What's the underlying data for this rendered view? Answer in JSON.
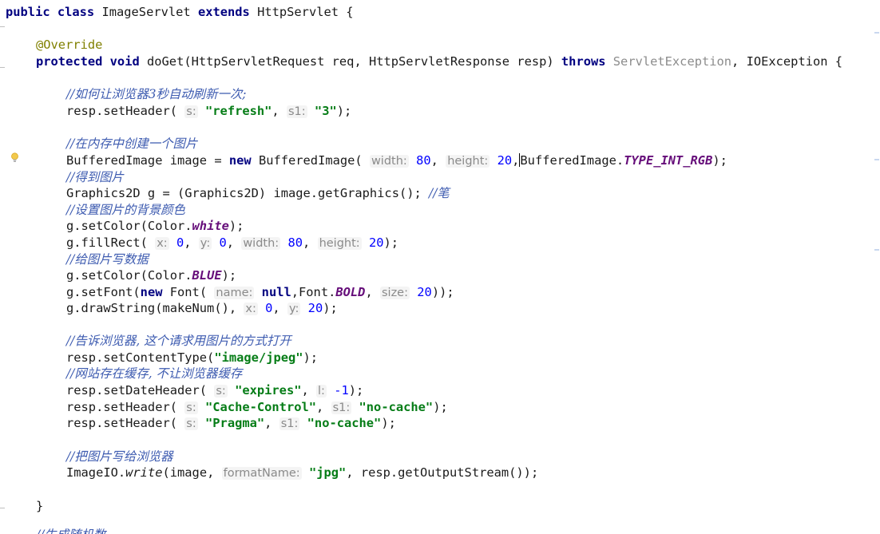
{
  "code": {
    "class_decl": {
      "kw1": "public class",
      "name": " ImageServlet ",
      "kw2": "extends",
      "rest": " HttpServlet {"
    },
    "override": "@Override",
    "method_decl": {
      "kw1": "protected void",
      "sig": " doGet(HttpServletRequest req, HttpServletResponse resp) ",
      "kw2": "throws",
      "ex1": " ServletException",
      "rest": ", IOException {"
    },
    "c1": "//如何让浏览器3秒自动刷新一次;",
    "l_refresh": {
      "pre": "resp.setHeader(",
      "h1": "s:",
      "v1": "\"refresh\"",
      "mid": ", ",
      "h2": "s1:",
      "v2": "\"3\"",
      "post": ");"
    },
    "c2": "//在内存中创建一个图片",
    "l_image": {
      "pre": "BufferedImage image = ",
      "kw": "new",
      "ctor": " BufferedImage(",
      "h1": "width:",
      "v1": "80",
      "sep1": ", ",
      "h2": "height:",
      "v2": "20",
      "sep2": ",",
      "cls": "BufferedImage.",
      "field": "TYPE_INT_RGB",
      "post": ");"
    },
    "c3": "//得到图片",
    "l_graphics": {
      "code": "Graphics2D g = (Graphics2D) image.getGraphics(); ",
      "cmt": "//笔"
    },
    "c4": "//设置图片的背景颜色",
    "l_setcolor1": {
      "pre": "g.setColor(Color.",
      "field": "white",
      "post": ");"
    },
    "l_fillrect": {
      "pre": "g.fillRect(",
      "h1": "x:",
      "v1": "0",
      "h2": "y:",
      "v2": "0",
      "h3": "width:",
      "v3": "80",
      "h4": "height:",
      "v4": "20",
      "post": ");"
    },
    "c5": "//给图片写数据",
    "l_setcolor2": {
      "pre": "g.setColor(Color.",
      "field": "BLUE",
      "post": ");"
    },
    "l_setfont": {
      "pre": "g.setFont(",
      "kw": "new",
      "ctor": " Font(",
      "h1": "name:",
      "v1": "null",
      "mid": ",Font.",
      "field": "BOLD",
      "sep": ", ",
      "h2": "size:",
      "v2": "20",
      "post": "));"
    },
    "l_drawstring": {
      "pre": "g.drawString(makeNum(), ",
      "h1": "x:",
      "v1": "0",
      "h2": "y:",
      "v2": "20",
      "post": ");"
    },
    "c6": "//告诉浏览器, 这个请求用图片的方式打开",
    "l_contenttype": {
      "pre": "resp.setContentType(",
      "v1": "\"image/jpeg\"",
      "post": ");"
    },
    "c7": "//网站存在缓存, 不让浏览器缓存",
    "l_dateheader": {
      "pre": "resp.setDateHeader(",
      "h1": "s:",
      "v1": "\"expires\"",
      "mid": ", ",
      "h2": "l:",
      "v2": "-1",
      "post": ");"
    },
    "l_cachecontrol": {
      "pre": "resp.setHeader(",
      "h1": "s:",
      "v1": "\"Cache-Control\"",
      "mid": ", ",
      "h2": "s1:",
      "v2": "\"no-cache\"",
      "post": ");"
    },
    "l_pragma": {
      "pre": "resp.setHeader(",
      "h1": "s:",
      "v1": "\"Pragma\"",
      "mid": ", ",
      "h2": "s1:",
      "v2": "\"no-cache\"",
      "post": ");"
    },
    "c8": "//把图片写给浏览器",
    "l_write": {
      "pre": "ImageIO.",
      "method": "write",
      "open": "(image, ",
      "h1": "formatName:",
      "v1": "\"jpg\"",
      "post": ", resp.getOutputStream());"
    },
    "close_brace": "}",
    "c9_partial": "//生成随机数"
  },
  "icons": {
    "intention": "lightbulb-icon"
  },
  "colors": {
    "keyword": "#000080",
    "string": "#067d17",
    "number": "#0000ff",
    "comment": "#3d5bb0",
    "annotation": "#808000",
    "static_field": "#660e7a",
    "hint": "#8a8a8a"
  }
}
